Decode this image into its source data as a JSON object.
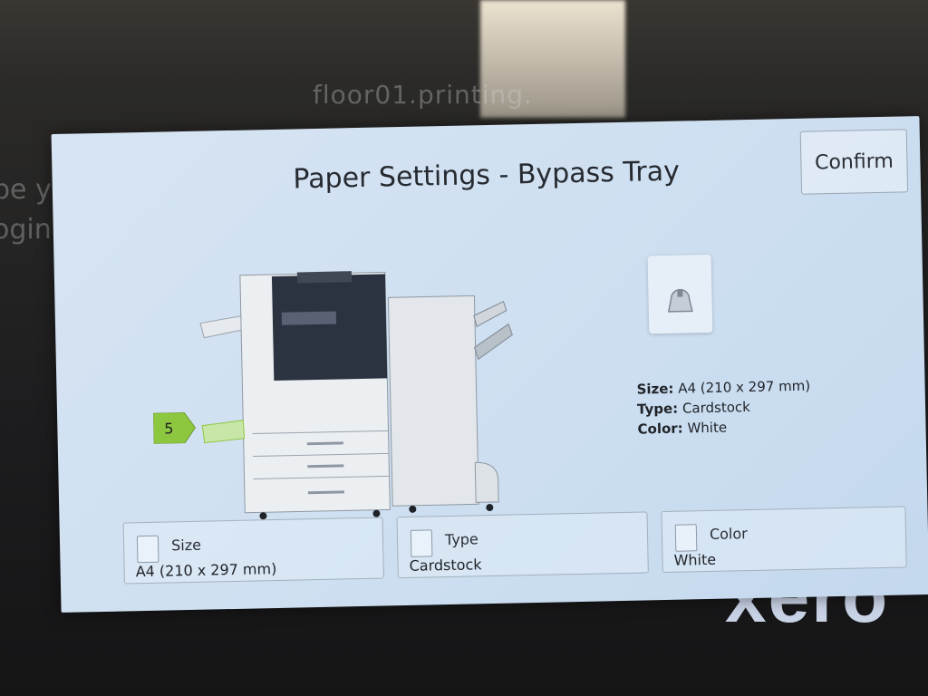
{
  "background": {
    "url_text": "floor01.printing.",
    "side_text_1": "pe y",
    "side_text_2": "ogin",
    "brand": "xero"
  },
  "dialog": {
    "title": "Paper Settings - Bypass Tray",
    "confirm_label": "Confirm",
    "tray_number": "5",
    "info": {
      "size_label": "Size:",
      "size_value": "A4 (210 x 297 mm)",
      "type_label": "Type:",
      "type_value": "Cardstock",
      "color_label": "Color:",
      "color_value": "White"
    },
    "cards": {
      "size": {
        "label": "Size",
        "value": "A4 (210 x 297 mm)"
      },
      "type": {
        "label": "Type",
        "value": "Cardstock"
      },
      "color": {
        "label": "Color",
        "value": "White"
      }
    }
  },
  "colors": {
    "panel": "#cfe0f1",
    "tray_badge": "#8dc63f",
    "text": "#262a30"
  },
  "icons": {
    "tray": "paper-tray-icon",
    "printer": "printer-illustration"
  }
}
